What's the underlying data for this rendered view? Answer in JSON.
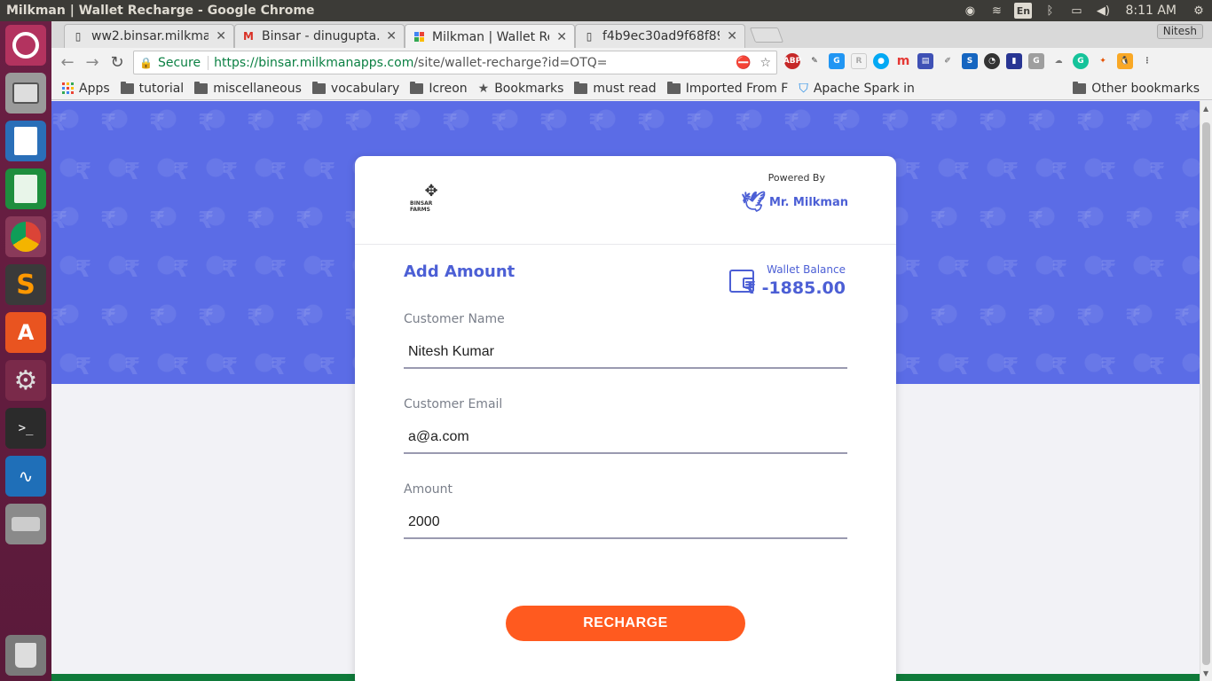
{
  "window": {
    "title": "Milkman | Wallet Recharge - Google Chrome",
    "clock": "8:11 AM",
    "keyboard": "En",
    "user": "Nitesh"
  },
  "tabs": [
    {
      "label": "ww2.binsar.milkma",
      "icon": "page-icon"
    },
    {
      "label": "Binsar - dinugupta.",
      "icon": "gmail-icon"
    },
    {
      "label": "Milkman | Wallet Re",
      "icon": "milkman-favicon",
      "active": true
    },
    {
      "label": "f4b9ec30ad9f68f89",
      "icon": "page-icon"
    }
  ],
  "profile": "Nitesh",
  "omnibox": {
    "secure": "Secure",
    "url_host": "https://binsar.milkmanapps.com",
    "url_rest": "/site/wallet-recharge?id=OTQ="
  },
  "bookmarks": {
    "items": [
      "Apps",
      "tutorial",
      "miscellaneous",
      "vocabulary",
      "Icreon",
      "Bookmarks",
      "must read",
      "Imported From F",
      "Apache Spark in"
    ],
    "other": "Other bookmarks"
  },
  "card": {
    "brand": "BINSAR FARMS",
    "powered_by": "Powered By",
    "provider": "Mr. Milkman",
    "heading": "Add Amount",
    "wallet_label": "Wallet Balance",
    "wallet_value": "₹ -1885.00",
    "fields": {
      "name_label": "Customer Name",
      "name_value": "Nitesh Kumar",
      "email_label": "Customer Email",
      "email_value": "a@a.com",
      "amount_label": "Amount",
      "amount_value": "2000"
    },
    "button": "RECHARGE"
  },
  "colors": {
    "accent": "#4c5fd5",
    "hero": "#5b6ce6",
    "button": "#ff5a1f"
  }
}
